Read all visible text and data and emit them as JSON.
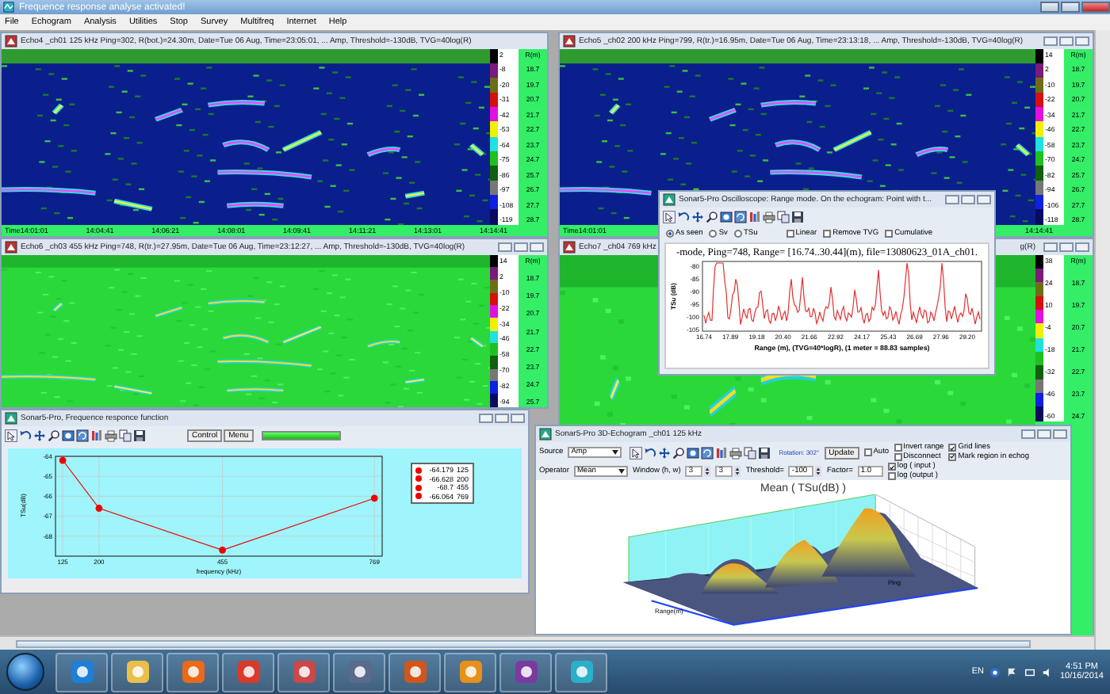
{
  "app": {
    "title": "Frequence response analyse activated!"
  },
  "menu": [
    "File",
    "Echogram",
    "Analysis",
    "Utilities",
    "Stop",
    "Survey",
    "Multifreq",
    "Internet",
    "Help"
  ],
  "echograms": [
    {
      "title": "Echo4 _ch01 125 kHz Ping=302, R(bot.)=24.30m, Date=Tue 06 Aug, Time=23:05:01, ... Amp, Threshold=-130dB, TVG=40log(R)",
      "kind": "dark",
      "controls": false,
      "scale_labels": [
        "2",
        "-8",
        "-20",
        "-31",
        "-42",
        "-53",
        "-64",
        "-75",
        "-86",
        "-97",
        "-108",
        "-119"
      ],
      "depth_unit": "R(m)",
      "depth_labels": [
        "18.7",
        "19.7",
        "20.7",
        "21.7",
        "22.7",
        "23.7",
        "24.7",
        "25.7",
        "26.7",
        "27.7",
        "28.7"
      ],
      "time_labels": [
        "Time14:01:01",
        "14:04:41",
        "14:06:21",
        "14:08:01",
        "14:09:41",
        "14:11:21",
        "14:13:01",
        "14:14:41"
      ]
    },
    {
      "title": "Echo5 _ch02 200 kHz Ping=799, R(tr.)=16.95m, Date=Tue 06 Aug, Time=23:13:18, ... Amp, Threshold=-130dB, TVG=40log(R)",
      "kind": "dark",
      "controls": true,
      "scale_labels": [
        "14",
        "2",
        "-10",
        "-22",
        "-34",
        "-46",
        "-58",
        "-70",
        "-82",
        "-94",
        "-106",
        "-118"
      ],
      "depth_unit": "R(m)",
      "depth_labels": [
        "18.7",
        "19.7",
        "20.7",
        "21.7",
        "22.7",
        "23.7",
        "24.7",
        "25.7",
        "26.7",
        "27.7",
        "28.7"
      ],
      "time_labels": [
        "Time14:01:01",
        "14:14:41"
      ]
    },
    {
      "title": "Echo6 _ch03 455 kHz Ping=748, R(tr.)=27.95m, Date=Tue 06 Aug, Time=23:12:27, ... Amp, Threshold=-130dB, TVG=40log(R)",
      "kind": "bright",
      "controls": true,
      "scale_labels": [
        "14",
        "2",
        "-10",
        "-22",
        "-34",
        "-46",
        "-58",
        "-70",
        "-82",
        "-94"
      ],
      "depth_unit": "R(m)",
      "depth_labels": [
        "18.7",
        "19.7",
        "20.7",
        "21.7",
        "22.7",
        "23.7",
        "24.7",
        "25.7"
      ]
    },
    {
      "title": "Echo7 _ch04 769 kHz",
      "title_end": "g(R)",
      "kind": "bright",
      "controls": true,
      "scale_labels": [
        "38",
        "24",
        "10",
        "-4",
        "-18",
        "-32",
        "-46",
        "-60"
      ],
      "depth_unit": "R(m)",
      "depth_labels": [
        "18.7",
        "19.7",
        "20.7",
        "21.7",
        "22.7",
        "23.7",
        "24.7"
      ]
    }
  ],
  "oscilloscope": {
    "title": "Sonar5-Pro Oscilloscope: Range mode. On the echogram: Point with t...",
    "modes": [
      {
        "label": "As seen",
        "selected": true
      },
      {
        "label": "Sv",
        "selected": false
      },
      {
        "label": "TSu",
        "selected": false
      }
    ],
    "options": [
      {
        "label": "Linear",
        "checked": false
      },
      {
        "label": "Remove TVG",
        "checked": false
      },
      {
        "label": "Cumulative",
        "checked": false
      }
    ],
    "heading": "-mode, Ping=748, Range= [16.74..30.44](m), file=13080623_01A_ch01.",
    "ylabel": "TSu (dB)",
    "y_labels": [
      "-80",
      "-85",
      "-90",
      "-95",
      "-100",
      "-105"
    ],
    "x_labels": [
      "16.74",
      "17.89",
      "19.18",
      "20.40",
      "21.66",
      "22.92",
      "24.17",
      "25.43",
      "26.69",
      "27.96",
      "29.20"
    ],
    "xlabel": "Range (m), (TVG=40*logR), (1 meter = 88.83 samples)"
  },
  "frequency_response": {
    "title": "Sonar5-Pro, Frequence responce function",
    "buttons": [
      "Control",
      "Menu"
    ],
    "progress": {
      "level": 1
    },
    "legend": [
      {
        "value": "-64.179",
        "frequency": "125",
        "color": "#ee0000"
      },
      {
        "value": "-66.628",
        "frequency": "200",
        "color": "#ee0000"
      },
      {
        "value": "-68.7",
        "frequency": "455",
        "color": "#ee0000"
      },
      {
        "value": "-66.064",
        "frequency": "769",
        "color": "#ee0000"
      }
    ],
    "chart_data": {
      "type": "line",
      "xlabel": "frequency (kHz)",
      "ylabel": "TSu(dB)",
      "x": [
        125,
        200,
        455,
        769
      ],
      "series": [
        {
          "color": "#ee0000",
          "marker": "circle",
          "values": [
            -64.2,
            -66.6,
            -68.7,
            -66.1
          ]
        }
      ],
      "grid": true,
      "xlim": [
        110,
        785
      ],
      "ylim": [
        -69,
        -64
      ],
      "xticks": [
        125,
        200,
        455,
        769
      ],
      "yticks": [
        -64,
        -65,
        -66,
        -67,
        -68
      ]
    }
  },
  "echogram_3d": {
    "title": "Sonar5-Pro 3D-Echogram _ch01 125 kHz",
    "source": {
      "label": "Source",
      "value": "Amp"
    },
    "rotation": "Rotation: 302°",
    "update": "Update",
    "checks_row1": [
      {
        "label": "Auto",
        "checked": false
      }
    ],
    "checks_col1": [
      {
        "label": "Invert range",
        "checked": false
      },
      {
        "label": "Disconnect",
        "checked": false
      }
    ],
    "checks_col2": [
      {
        "label": "Grid lines",
        "checked": true
      },
      {
        "label": "Mark region in echog",
        "checked": true
      }
    ],
    "operator": {
      "label": "Operator",
      "value": "Mean"
    },
    "window": {
      "label": "Window (h, w)",
      "values": [
        "3",
        "3"
      ]
    },
    "threshold": {
      "label": "Threshold=",
      "value": "-100"
    },
    "factor": {
      "label": "Factor=",
      "value": "1.0"
    },
    "checks_col3": [
      {
        "label": "log ( input )",
        "checked": true
      },
      {
        "label": "log (output )",
        "checked": false
      }
    ],
    "chart_title": "Mean ( TSu(dB) )",
    "axis_ping": "Ping",
    "axis_range": "Range(m)"
  },
  "taskbar": {
    "apps": [
      {
        "color": "#1e7fd6"
      },
      {
        "color": "#e8c04a"
      },
      {
        "color": "#e86a1a"
      },
      {
        "color": "#d93a2b"
      },
      {
        "color": "#c94848"
      },
      {
        "color": "#5a6a8a"
      },
      {
        "color": "#d0561c"
      },
      {
        "color": "#e8901a"
      },
      {
        "color": "#7b3aa0"
      },
      {
        "color": "#2ab0c8"
      }
    ],
    "language": "EN",
    "time": "4:51 PM",
    "date": "10/16/2014"
  }
}
